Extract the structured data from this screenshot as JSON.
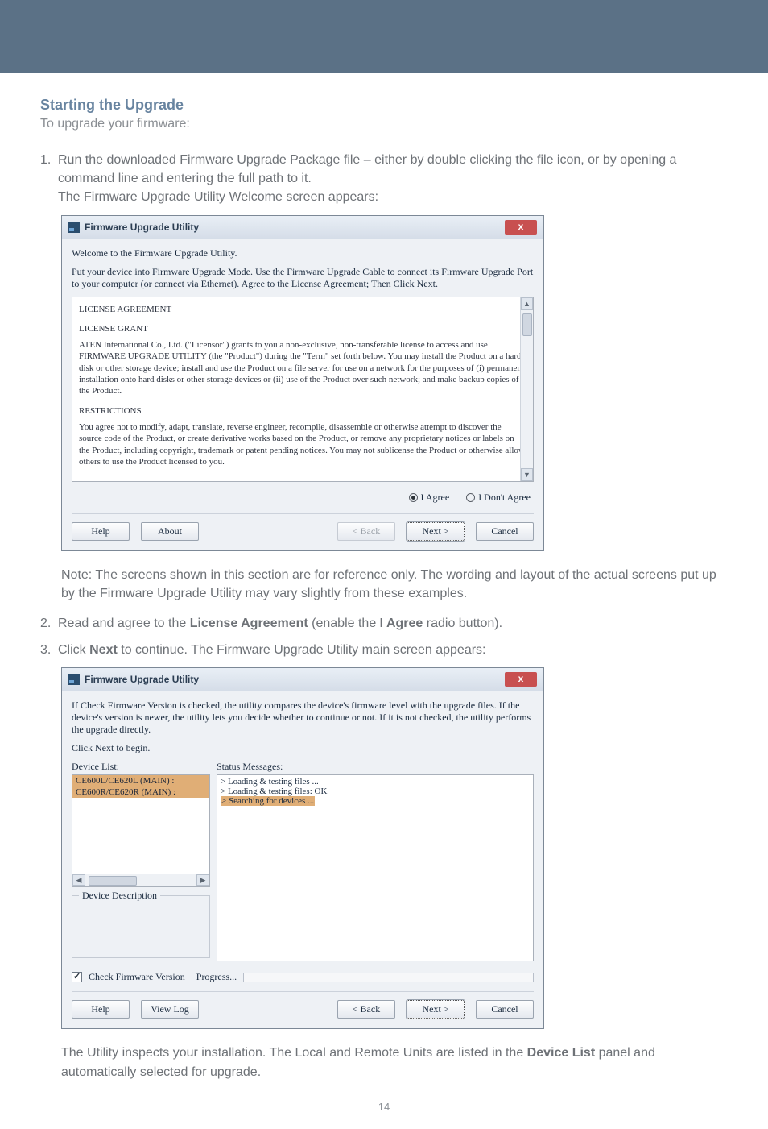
{
  "heading": "Starting the Upgrade",
  "subheading": "To upgrade your firmware:",
  "step1_num": "1.",
  "step1_a": "Run the downloaded Firmware Upgrade Package file – either by double clicking the file icon, or by opening a command line and entering the full path to it.",
  "step1_b": "The Firmware Upgrade Utility Welcome screen appears:",
  "note_text": "Note: The screens shown in this section are for reference only. The wording and layout of the actual screens put up by the Firmware Upgrade Utility may vary slightly from these examples.",
  "step2_num": "2.",
  "step2_pre": "Read and agree to the ",
  "step2_bold1": "License Agreement",
  "step2_mid": " (enable the ",
  "step2_bold2": "I Agree",
  "step2_post": " radio button).",
  "step3_num": "3.",
  "step3_pre": "Click ",
  "step3_bold": "Next",
  "step3_post": " to continue. The Firmware Upgrade Utility main screen appears:",
  "tail_pre": "The Utility inspects your installation. The Local and Remote Units are listed in the ",
  "tail_bold": "Device List",
  "tail_post": " panel and automatically selected for upgrade.",
  "page_number": "14",
  "dialog1": {
    "title": "Firmware Upgrade Utility",
    "close": "x",
    "welcome": "Welcome to the Firmware Upgrade Utility.",
    "instruction": "Put your device into Firmware Upgrade Mode. Use the Firmware Upgrade Cable to connect its Firmware Upgrade Port to your computer (or connect via Ethernet). Agree to the License Agreement; Then Click Next.",
    "license_heading": "LICENSE AGREEMENT",
    "grant_heading": "LICENSE GRANT",
    "grant_body": "ATEN International Co., Ltd. (\"Licensor\") grants to you a non-exclusive, non-transferable license to access and use FIRMWARE UPGRADE UTILITY (the \"Product\") during the \"Term\" set forth below. You may install the Product on a hard disk or other storage device; install and use the Product on a file server for use on a network for the purposes of (i) permanent installation onto hard disks or other storage devices or (ii) use of the Product over such network; and make backup copies of the Product.",
    "restrict_heading": "RESTRICTIONS",
    "restrict_body": "You agree not to modify, adapt, translate, reverse engineer, recompile, disassemble or otherwise attempt to discover the source code of the Product, or create derivative works based on the Product, or remove any proprietary notices or labels on the Product, including copyright, trademark or patent pending notices. You may not sublicense the Product or otherwise allow others to use the Product licensed to you.",
    "radio_agree": "I Agree",
    "radio_disagree": "I Don't Agree",
    "btn_help": "Help",
    "btn_about": "About",
    "btn_back": "< Back",
    "btn_next": "Next >",
    "btn_cancel": "Cancel"
  },
  "dialog2": {
    "title": "Firmware Upgrade Utility",
    "close": "x",
    "intro": "If Check Firmware Version is checked, the utility compares the device's firmware level with the upgrade files. If the device's version is newer, the utility lets you decide whether to continue or not. If it is not checked, the utility performs the upgrade directly.",
    "click_next": "Click Next to begin.",
    "device_list_label": "Device List:",
    "status_label": "Status Messages:",
    "device_items": [
      "CE600L/CE620L (MAIN) :",
      "CE600R/CE620R (MAIN) :"
    ],
    "status_lines": [
      "> Loading & testing files ...",
      "> Loading & testing files: OK",
      "> Searching for devices ..."
    ],
    "desc_legend": "Device Description",
    "check_label": "Check Firmware Version",
    "progress_label": "Progress...",
    "btn_help": "Help",
    "btn_viewlog": "View Log",
    "btn_back": "< Back",
    "btn_next": "Next >",
    "btn_cancel": "Cancel"
  }
}
